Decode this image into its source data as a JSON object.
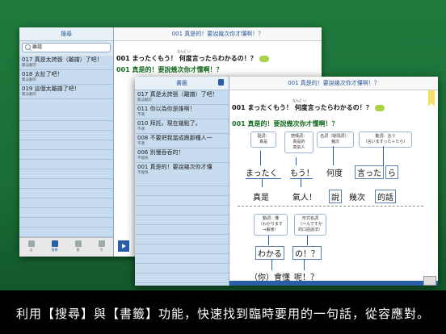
{
  "back": {
    "search_header": "搜尋",
    "search_value": "離譜",
    "results": [
      {
        "title": "017 真是太誇張（離譜）了吧！",
        "sub": "無法翻可"
      },
      {
        "title": "018 太扯了吧！",
        "sub": "無法翻可"
      },
      {
        "title": "019 這個太離譜了吧！",
        "sub": "無法翻可"
      }
    ],
    "tabs": [
      "出",
      "搜尋",
      "書",
      "字"
    ],
    "right_header": "001 真是的！要說幾次你才懂啊！？",
    "jp": "001 まったくもう！ 何度言ったらわかるの！？",
    "furigana": "なんど  い",
    "zh": "001 真是的！要說幾次你才懂啊！？"
  },
  "front": {
    "bookmark_header": "書籤",
    "bookmarks": [
      {
        "title": "017 真是太誇張（離譜）了吧！",
        "sub": "無法翻可"
      },
      {
        "title": "011 你以為你是誰啊！",
        "sub": "不適"
      },
      {
        "title": "010 拜託，現在幾點了。",
        "sub": "不適"
      },
      {
        "title": "008 不要把我當成跟那種人一",
        "sub": "不適"
      },
      {
        "title": "006 別慢吞吞的！",
        "sub": "不能快"
      },
      {
        "title": "001 真是的！要說幾次你才懂",
        "sub": "不能快"
      }
    ],
    "right_header": "001 真是的！要說幾次你才懂啊！？",
    "jp": "001 まったくもう！ 何度言ったらわかるの！？",
    "furigana": "なんど  い",
    "zh": "001 真是的！要說幾次你才懂啊！？",
    "callouts": [
      "副詞：\n真是",
      "感嘆詞：\n真是的\n真氣人",
      "名詞（疑問詞）：\n幾次",
      "動詞：言う\n（言いますった＋たら）",
      "動詞：懂\n（わかります\n⇒解會）",
      "形式名詞\n（〜んですか\n的口語說法）"
    ],
    "jp_words": [
      "まったく",
      "もう！",
      "何度",
      "言った",
      "ら"
    ],
    "zh_words": [
      "真是",
      "氣人！",
      "說",
      "幾次",
      "的話"
    ],
    "jp_words2": [
      "わかる",
      "の！？"
    ],
    "zh_words2": [
      "（你）會懂",
      "呢！？"
    ]
  },
  "caption": "利用【搜尋】與【書籤】功能，快速找到臨時要用的一句話，從容應對。"
}
